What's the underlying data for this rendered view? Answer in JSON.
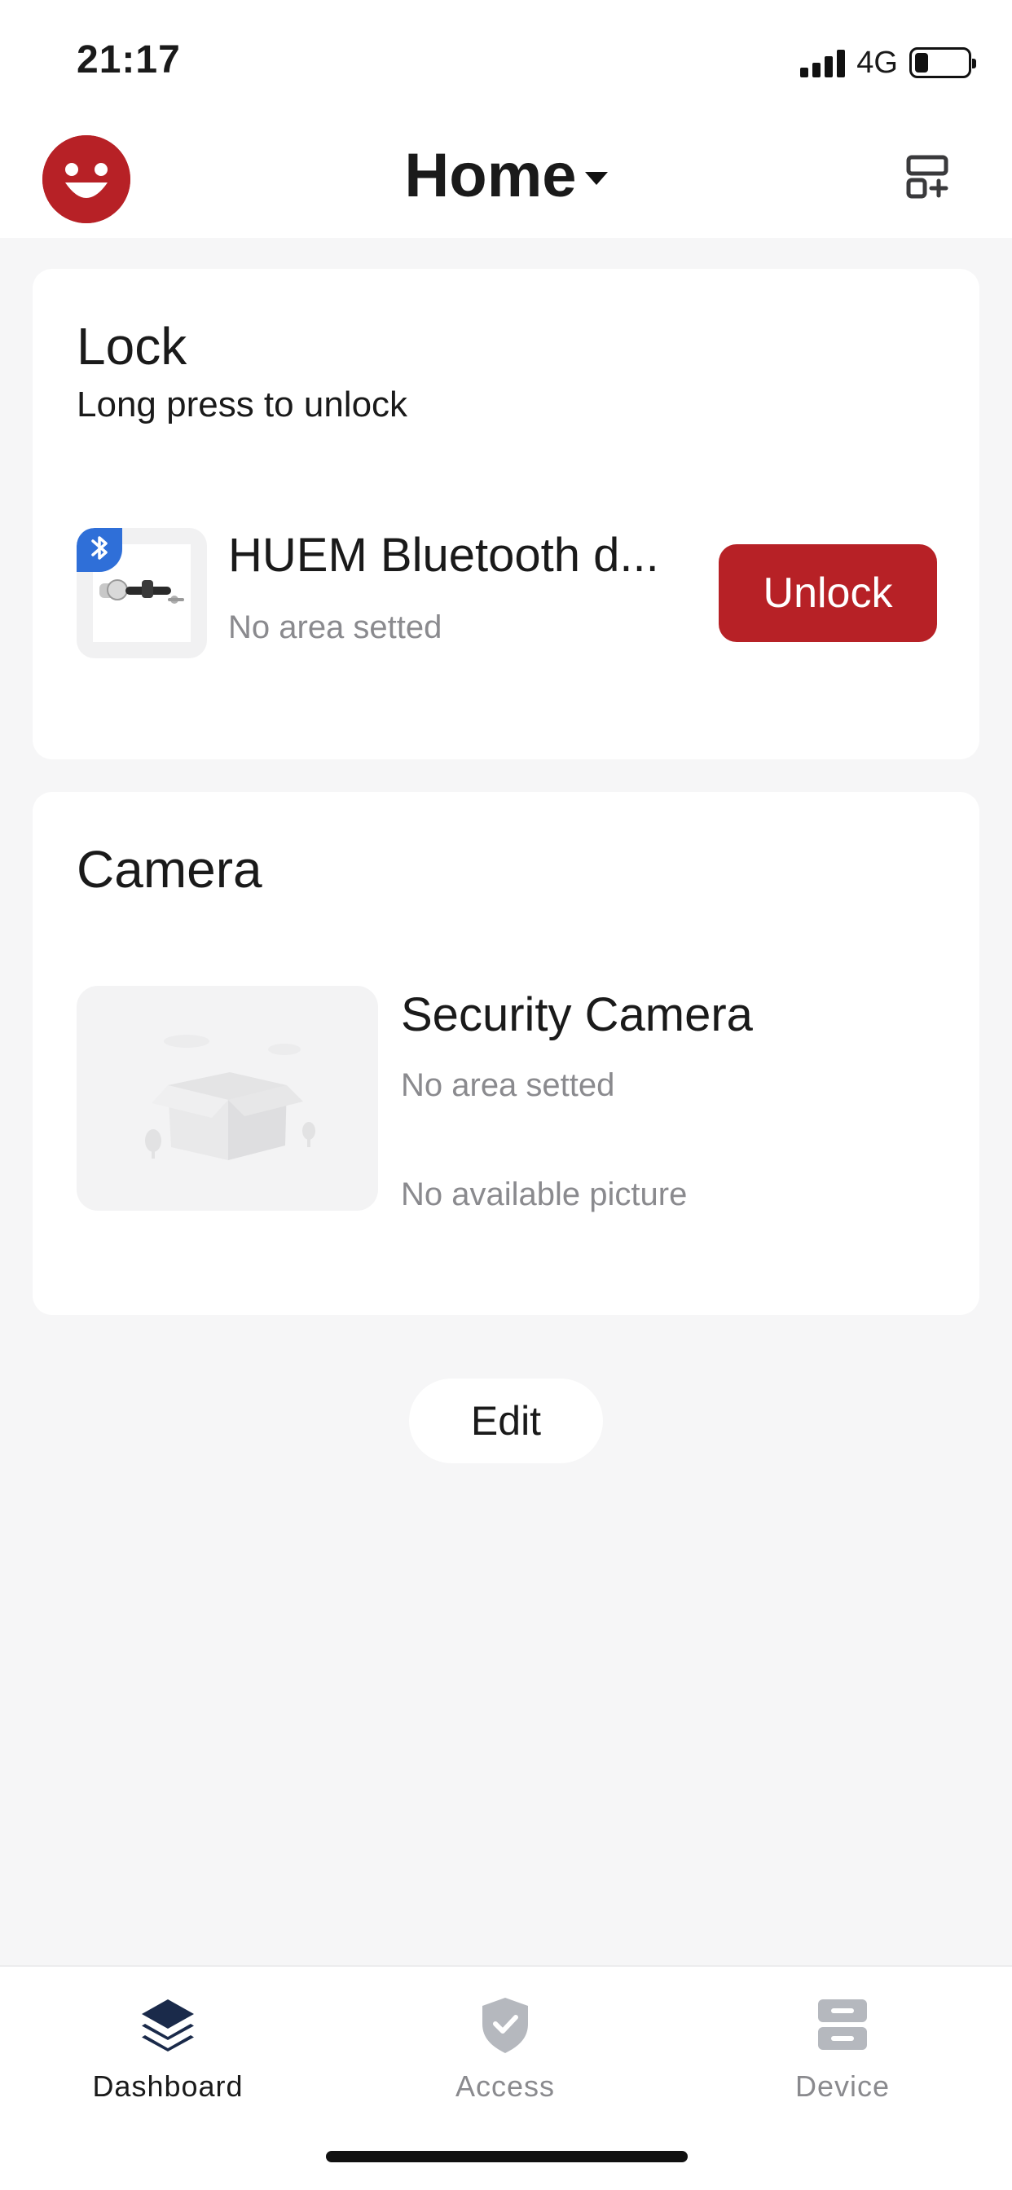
{
  "status_bar": {
    "time": "21:17",
    "network": "4G",
    "battery_level": 0.2
  },
  "header": {
    "title": "Home",
    "avatar_icon": "smiley-face-icon",
    "add_icon": "add-layout-icon",
    "brand_color": "#b72126"
  },
  "lock_card": {
    "title": "Lock",
    "subtitle": "Long press to unlock",
    "device": {
      "name": "HUEM Bluetooth d...",
      "area": "No area setted",
      "badge_icon": "bluetooth-icon",
      "action_label": "Unlock"
    }
  },
  "camera_card": {
    "title": "Camera",
    "device": {
      "name": "Security Camera",
      "area": "No area setted",
      "picture_status": "No available picture",
      "placeholder_icon": "empty-box-icon"
    }
  },
  "edit_label": "Edit",
  "tabbar": {
    "items": [
      {
        "label": "Dashboard",
        "icon": "layers-icon",
        "active": true
      },
      {
        "label": "Access",
        "icon": "shield-check-icon",
        "active": false
      },
      {
        "label": "Device",
        "icon": "server-icon",
        "active": false
      }
    ],
    "active_color": "#1a2a4a",
    "inactive_color": "#8a8a8e"
  }
}
